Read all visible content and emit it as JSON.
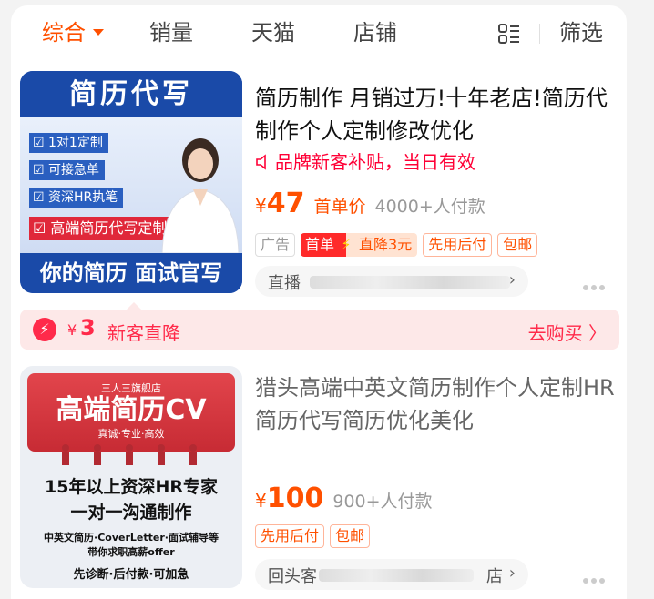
{
  "tabs": {
    "items": [
      {
        "label": "综合"
      },
      {
        "label": "销量"
      },
      {
        "label": "天猫"
      },
      {
        "label": "店铺"
      }
    ],
    "filter_label": "筛选"
  },
  "products": [
    {
      "title": "简历制作 月销过万!十年老店!简历代制作个人定制修改优化",
      "promo": "品牌新客补贴，当日有效",
      "price_symbol": "¥",
      "price": "47",
      "price_note": "首单价",
      "sold": "4000+人付款",
      "tags": {
        "ad": "广告",
        "first_order": "首单",
        "bolt": "⚡",
        "discount": "直降3元",
        "pay_later": "先用后付",
        "free_ship": "包邮"
      },
      "shop_prefix": "直播",
      "image": {
        "heading": "简历代写",
        "bullets": [
          "☑ 1对1定制",
          "☑ 可接急单",
          "☑ 资深HR执笔",
          "☑ 高端简历代写定制"
        ],
        "footer": "你的简历  面试官写"
      }
    },
    {
      "title": "猎头高端中英文简历制作个人定制HR简历代写简历优化美化",
      "price_symbol": "¥",
      "price": "100",
      "sold": "900+人付款",
      "tags": {
        "pay_later": "先用后付",
        "free_ship": "包邮"
      },
      "shop_prefix": "回头客",
      "shop_suffix": "店",
      "image": {
        "store": "三人三旗舰店",
        "heading": "高端简历CV",
        "sub": "真诚·专业·高效",
        "line1": "15年以上资深HR专家",
        "line2": "一对一沟通制作",
        "line3": "中英文简历·CoverLetter·面试辅导等",
        "line4": "带你求职高薪offer",
        "line5": "先诊断·后付款·可加急"
      }
    }
  ],
  "new_customer": {
    "icon": "⚡",
    "yen": "¥",
    "amount": "3",
    "label": "新客直降",
    "action": "去购买 〉"
  },
  "colors": {
    "accent": "#ff5000",
    "promo_red": "#ff2a4a",
    "tmall_red": "#ff0036"
  }
}
